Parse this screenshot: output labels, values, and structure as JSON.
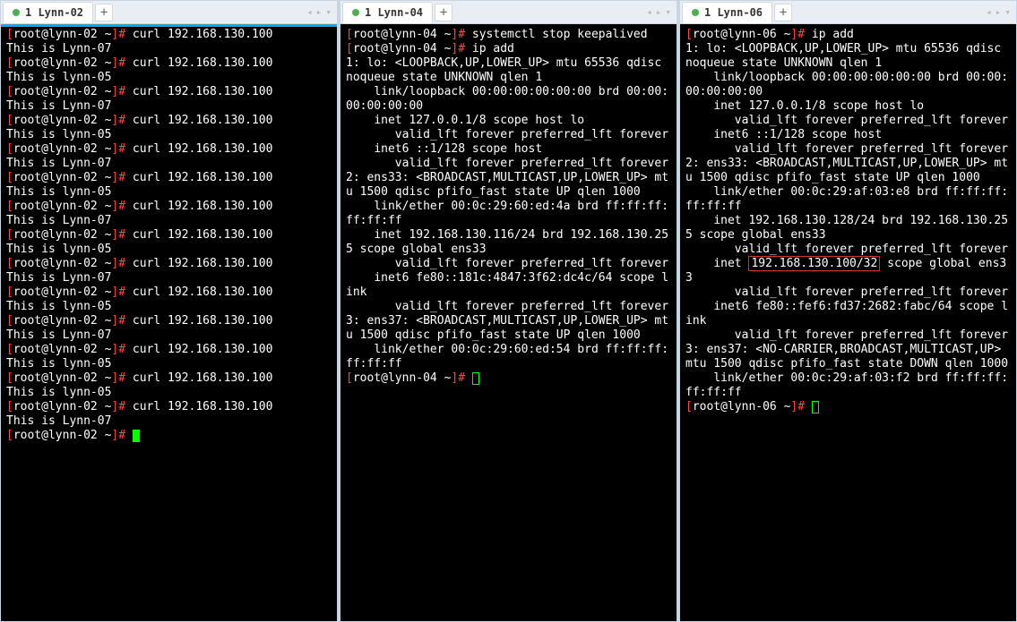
{
  "terminals": [
    {
      "tab": "1 Lynn-02",
      "active": true,
      "content": [
        {
          "t": "prompt",
          "user": "root@lynn-02",
          "dir": "~",
          "cmd": "curl 192.168.130.100"
        },
        {
          "t": "out",
          "text": "This is Lynn-07"
        },
        {
          "t": "prompt",
          "user": "root@lynn-02",
          "dir": "~",
          "cmd": "curl 192.168.130.100"
        },
        {
          "t": "out",
          "text": "This is lynn-05"
        },
        {
          "t": "prompt",
          "user": "root@lynn-02",
          "dir": "~",
          "cmd": "curl 192.168.130.100"
        },
        {
          "t": "out",
          "text": "This is Lynn-07"
        },
        {
          "t": "prompt",
          "user": "root@lynn-02",
          "dir": "~",
          "cmd": "curl 192.168.130.100"
        },
        {
          "t": "out",
          "text": "This is lynn-05"
        },
        {
          "t": "prompt",
          "user": "root@lynn-02",
          "dir": "~",
          "cmd": "curl 192.168.130.100"
        },
        {
          "t": "out",
          "text": "This is Lynn-07"
        },
        {
          "t": "prompt",
          "user": "root@lynn-02",
          "dir": "~",
          "cmd": "curl 192.168.130.100"
        },
        {
          "t": "out",
          "text": "This is lynn-05"
        },
        {
          "t": "prompt",
          "user": "root@lynn-02",
          "dir": "~",
          "cmd": "curl 192.168.130.100"
        },
        {
          "t": "out",
          "text": "This is Lynn-07"
        },
        {
          "t": "prompt",
          "user": "root@lynn-02",
          "dir": "~",
          "cmd": "curl 192.168.130.100"
        },
        {
          "t": "out",
          "text": "This is lynn-05"
        },
        {
          "t": "prompt",
          "user": "root@lynn-02",
          "dir": "~",
          "cmd": "curl 192.168.130.100"
        },
        {
          "t": "out",
          "text": "This is Lynn-07"
        },
        {
          "t": "prompt",
          "user": "root@lynn-02",
          "dir": "~",
          "cmd": "curl 192.168.130.100"
        },
        {
          "t": "out",
          "text": "This is lynn-05"
        },
        {
          "t": "prompt",
          "user": "root@lynn-02",
          "dir": "~",
          "cmd": "curl 192.168.130.100"
        },
        {
          "t": "out",
          "text": "This is Lynn-07"
        },
        {
          "t": "prompt",
          "user": "root@lynn-02",
          "dir": "~",
          "cmd": "curl 192.168.130.100"
        },
        {
          "t": "out",
          "text": "This is lynn-05"
        },
        {
          "t": "prompt",
          "user": "root@lynn-02",
          "dir": "~",
          "cmd": "curl 192.168.130.100"
        },
        {
          "t": "out",
          "text": "This is lynn-05"
        },
        {
          "t": "prompt",
          "user": "root@lynn-02",
          "dir": "~",
          "cmd": "curl 192.168.130.100"
        },
        {
          "t": "out",
          "text": "This is Lynn-07"
        },
        {
          "t": "prompt",
          "user": "root@lynn-02",
          "dir": "~",
          "cmd": "",
          "cursor": "solid"
        }
      ]
    },
    {
      "tab": "1 Lynn-04",
      "active": false,
      "content": [
        {
          "t": "prompt",
          "user": "root@lynn-04",
          "dir": "~",
          "cmd": "systemctl stop keepalived"
        },
        {
          "t": "prompt",
          "user": "root@lynn-04",
          "dir": "~",
          "cmd": "ip add"
        },
        {
          "t": "out",
          "text": "1: lo: <LOOPBACK,UP,LOWER_UP> mtu 65536 qdisc noqueue state UNKNOWN qlen 1"
        },
        {
          "t": "out",
          "text": "    link/loopback 00:00:00:00:00:00 brd 00:00:00:00:00:00"
        },
        {
          "t": "out",
          "text": "    inet 127.0.0.1/8 scope host lo"
        },
        {
          "t": "out",
          "text": "       valid_lft forever preferred_lft forever"
        },
        {
          "t": "out",
          "text": "    inet6 ::1/128 scope host"
        },
        {
          "t": "out",
          "text": "       valid_lft forever preferred_lft forever"
        },
        {
          "t": "out",
          "text": "2: ens33: <BROADCAST,MULTICAST,UP,LOWER_UP> mtu 1500 qdisc pfifo_fast state UP qlen 1000"
        },
        {
          "t": "out",
          "text": "    link/ether 00:0c:29:60:ed:4a brd ff:ff:ff:ff:ff:ff"
        },
        {
          "t": "out",
          "text": "    inet 192.168.130.116/24 brd 192.168.130.255 scope global ens33"
        },
        {
          "t": "out",
          "text": "       valid_lft forever preferred_lft forever"
        },
        {
          "t": "out",
          "text": "    inet6 fe80::181c:4847:3f62:dc4c/64 scope link"
        },
        {
          "t": "out",
          "text": "       valid_lft forever preferred_lft forever"
        },
        {
          "t": "out",
          "text": "3: ens37: <BROADCAST,MULTICAST,UP,LOWER_UP> mtu 1500 qdisc pfifo_fast state UP qlen 1000"
        },
        {
          "t": "out",
          "text": "    link/ether 00:0c:29:60:ed:54 brd ff:ff:ff:ff:ff:ff"
        },
        {
          "t": "prompt",
          "user": "root@lynn-04",
          "dir": "~",
          "cmd": "",
          "cursor": "box"
        }
      ]
    },
    {
      "tab": "1 Lynn-06",
      "active": false,
      "content": [
        {
          "t": "prompt",
          "user": "root@lynn-06",
          "dir": "~",
          "cmd": "ip add"
        },
        {
          "t": "out",
          "text": "1: lo: <LOOPBACK,UP,LOWER_UP> mtu 65536 qdisc noqueue state UNKNOWN qlen 1"
        },
        {
          "t": "out",
          "text": "    link/loopback 00:00:00:00:00:00 brd 00:00:00:00:00:00"
        },
        {
          "t": "out",
          "text": "    inet 127.0.0.1/8 scope host lo"
        },
        {
          "t": "out",
          "text": "       valid_lft forever preferred_lft forever"
        },
        {
          "t": "out",
          "text": "    inet6 ::1/128 scope host"
        },
        {
          "t": "out",
          "text": "       valid_lft forever preferred_lft forever"
        },
        {
          "t": "out",
          "text": "2: ens33: <BROADCAST,MULTICAST,UP,LOWER_UP> mtu 1500 qdisc pfifo_fast state UP qlen 1000"
        },
        {
          "t": "out",
          "text": "    link/ether 00:0c:29:af:03:e8 brd ff:ff:ff:ff:ff:ff"
        },
        {
          "t": "out",
          "text": "    inet 192.168.130.128/24 brd 192.168.130.255 scope global ens33"
        },
        {
          "t": "out",
          "text": "       valid_lft forever preferred_lft forever"
        },
        {
          "t": "hl",
          "pre": "    inet ",
          "box": "192.168.130.100/32",
          "post": " scope global ens33"
        },
        {
          "t": "out",
          "text": "       valid_lft forever preferred_lft forever"
        },
        {
          "t": "out",
          "text": "    inet6 fe80::fef6:fd37:2682:fabc/64 scope link"
        },
        {
          "t": "out",
          "text": "       valid_lft forever preferred_lft forever"
        },
        {
          "t": "out",
          "text": "3: ens37: <NO-CARRIER,BROADCAST,MULTICAST,UP> mtu 1500 qdisc pfifo_fast state DOWN qlen 1000"
        },
        {
          "t": "out",
          "text": "    link/ether 00:0c:29:af:03:f2 brd ff:ff:ff:ff:ff:ff"
        },
        {
          "t": "prompt",
          "user": "root@lynn-06",
          "dir": "~",
          "cmd": "",
          "cursor": "box"
        }
      ]
    }
  ],
  "nav": {
    "left": "◂",
    "right": "▸",
    "down": "▾"
  }
}
